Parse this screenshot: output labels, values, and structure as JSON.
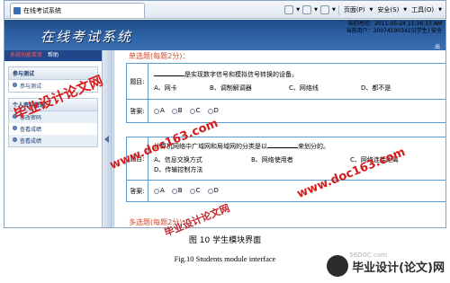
{
  "browser": {
    "tab_title": "在线考试系统",
    "menu_page": "页面(P)",
    "menu_safety": "安全(S)",
    "menu_tools": "工具(O)"
  },
  "header": {
    "title": "在线考试系统",
    "time_label": "当前时间：2011-05-24 11:36:33 AM",
    "user_label": "当前用户：200741903415[学生]",
    "safe_label": "安全",
    "exit_label": "出"
  },
  "sidebar": {
    "top_left": "系统功能菜单",
    "top_right": "帮助",
    "groups": [
      {
        "title": "参与测试",
        "items": [
          "参与测试"
        ]
      },
      {
        "title": "个人资料管理",
        "items": [
          "修改密码",
          "查看成绩",
          "查看成绩"
        ]
      }
    ]
  },
  "main": {
    "single_heading": "单选题(每题2分)：",
    "q_label": "题目:",
    "a_label": "答案:",
    "questions": [
      {
        "stem": "是实现数字信号和模拟信号转换的设备。",
        "options": [
          "A、网卡",
          "B、调制解调器",
          "C、网络线",
          "D、都不是"
        ],
        "choices": [
          "A",
          "B",
          "C",
          "D"
        ]
      },
      {
        "stem_pre": "计算机网络中广域网和局域网的分类是以",
        "stem_post": "来划分的。",
        "options": [
          "A、信息交换方式",
          "B、网络使用者",
          "C、网络连接距离",
          "D、传输控制方法"
        ],
        "choices": [
          "A",
          "B",
          "C",
          "D"
        ]
      }
    ],
    "multi_heading": "多选题(每题2分)："
  },
  "captions": {
    "cn": "图 10   学生模块界面",
    "en": "Fig.10    Students module interface"
  },
  "watermarks": {
    "w1": "毕业设计论文网",
    "w2": "www.doc163.com",
    "w3": "www.doc163.com",
    "w4": "毕业设计论文网",
    "logo_text": "毕业设计(论文)网",
    "logo_small": "56DOC.com"
  }
}
